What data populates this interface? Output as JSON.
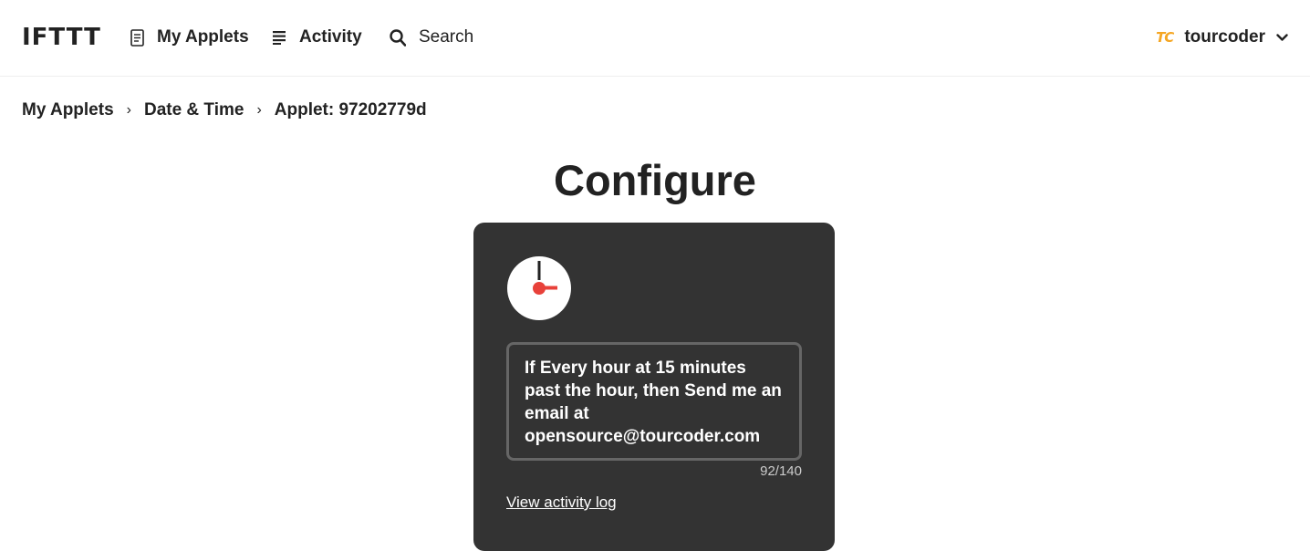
{
  "header": {
    "logo": "IFTTT",
    "nav": {
      "my_applets": "My Applets",
      "activity": "Activity",
      "search": "Search"
    },
    "user": {
      "avatar_initials": "TC",
      "username": "tourcoder"
    },
    "icons": {
      "my_applets": "document-icon",
      "activity": "list-icon",
      "search": "magnifier-icon",
      "user_menu": "chevron-down-icon"
    }
  },
  "breadcrumb": {
    "items": [
      "My Applets",
      "Date & Time",
      "Applet: 97202779d"
    ],
    "separator": "›"
  },
  "main": {
    "title": "Configure",
    "card": {
      "service_icon": "clock-icon",
      "description": "If Every hour at 15 minutes past the hour, then Send me an email at opensource@tourcoder.com",
      "char_count": "92/140",
      "activity_link": "View activity log"
    }
  },
  "colors": {
    "card_background": "#333333",
    "clock_accent": "#e8413a",
    "avatar_accent": "#f5a623",
    "text_dark": "#222222"
  }
}
